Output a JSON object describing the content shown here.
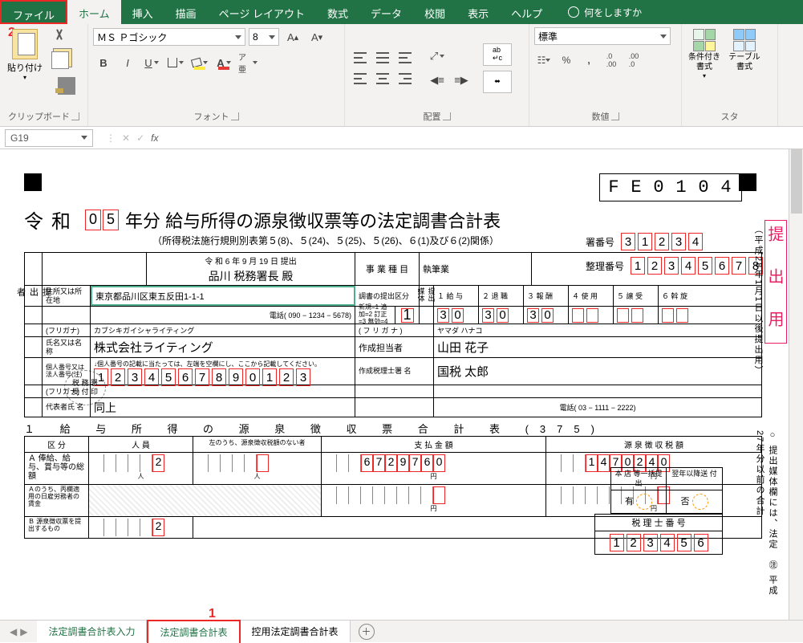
{
  "ribbon": {
    "tabs": [
      "ファイル",
      "ホーム",
      "挿入",
      "描画",
      "ページ レイアウト",
      "数式",
      "データ",
      "校閲",
      "表示",
      "ヘルプ"
    ],
    "tell_me": "何をしますか",
    "clipboard_label": "クリップボード",
    "paste_label": "貼り付け",
    "font_label": "フォント",
    "font_name": "ＭＳ Ｐゴシック",
    "font_size": "8",
    "alignment_label": "配置",
    "number_label": "数値",
    "number_format": "標準",
    "styles_label": "スタ",
    "cond_format": "条件付き書式",
    "table_format": "テーブル書式"
  },
  "fx": {
    "name_box": "G19"
  },
  "doc": {
    "code": [
      "F",
      "E",
      "0",
      "1",
      "0",
      "4"
    ],
    "era": "令和",
    "year": [
      "0",
      "5"
    ],
    "title_suffix": "年分 給与所得の源泉徴収票等の法定調書合計表",
    "subtitle": "（所得税法施行規則別表第５(8)、５(24)、５(25)、５(26)、６(1)及び６(2)関係）",
    "office_no_lbl": "署番号",
    "office_no": [
      "3",
      "1",
      "2",
      "3",
      "4"
    ],
    "seiri_lbl": "整理番号",
    "seiri": [
      "1",
      "2",
      "3",
      "4",
      "5",
      "6",
      "7",
      "8"
    ],
    "submit_date": "令 和 6 年 9 月 19 日 提出",
    "tax_office": "品川 税務署長 殿",
    "stamp_lbl1": "税 務 署",
    "stamp_lbl2": "受 付 印",
    "vert_pink": "提 出 用",
    "vert_side": "（平成28年1月1日以後提出用）",
    "vert_side2": "○ 提出媒体欄には、法定",
    "vert_side3": "㊟ 平成27年分以前の合計",
    "f": {
      "teishutsu": "提出者",
      "addr_lbl": "住所又は所在地",
      "addr": "東京都品川区東五反田1-1-1",
      "tel_lbl": "電話(",
      "tel": "090  −  1234  −  5678",
      "furi1_lbl": "(フリガナ)",
      "furi1": "カブシキガイシャライティング",
      "name_lbl": "氏名又は名  称",
      "name": "株式会社ライティング",
      "kojin_lbl": "個人番号又は法人番号(注)",
      "kojin_note": "↓個人番号の記載に当たっては、左端を空欄にし、ここから記載してください。",
      "kojin": [
        "1",
        "2",
        "3",
        "4",
        "5",
        "6",
        "7",
        "8",
        "9",
        "0",
        "1",
        "2",
        "3"
      ],
      "furi2_lbl": "(フリガナ)",
      "daihyo_lbl": "代表者氏  名",
      "daihyo": "同上",
      "gyoshu_lbl": "事 業 種 目",
      "gyoshu": "執筆業",
      "chosho_lbl": "調書の提出区分",
      "chosho_note": "新規=1 追加=2 訂正=3 無効=4",
      "chosho_val": "1",
      "media_lbl": "提出媒体",
      "media_cols": [
        "１ 給 与",
        "２ 退 職",
        "３ 報 酬",
        "４ 使 用",
        "５ 譲 受",
        "６ 斡 旋"
      ],
      "media_vals": [
        [
          "3",
          "0"
        ],
        [
          "3",
          "0"
        ],
        [
          "3",
          "0"
        ],
        [
          "",
          ""
        ],
        [
          "",
          ""
        ],
        [
          "",
          ""
        ]
      ],
      "sakusei_furi_lbl": "( フ リ ガ ナ )",
      "sakusei_furi": "ヤマダ ハナコ",
      "sakusei_lbl": "作成担当者",
      "sakusei": "山田 花子",
      "zeirishi_lbl": "作成税理士署  名",
      "zeirishi": "国税 太郎",
      "zeirishi_tel_lbl": "電話(",
      "zeirishi_tel": "03  −  1111  −  2222",
      "honten1": "本 店 等一括提出",
      "honten2": "翌年以降送  付",
      "honten_a": "有",
      "honten_b": "否",
      "zeirishi_no_lbl": "税 理 士 番 号",
      "zeirishi_no": [
        "1",
        "2",
        "3",
        "4",
        "5",
        "6"
      ]
    },
    "sec1": {
      "title": "１  給 与 所 得 の 源 泉 徴 収 票 合 計 表 (375)",
      "cols": [
        "区  分",
        "人  員",
        "",
        "支  払  金  額",
        "源 泉 徴 収 税 額"
      ],
      "note": "左のうち、源泉徴収税額のない者",
      "row1_lbl": "Ａ 俸給、給与、賞与等の総額",
      "row2_lbl": "Ａのうち、丙欄適用の日雇労務者の賃金",
      "row3_lbl": "Ｂ 源泉徴収票を提出するもの",
      "jinnin": "2",
      "pay": [
        "",
        "",
        "6",
        "7",
        "2",
        "9",
        "7",
        "6",
        "0"
      ],
      "tax": [
        "",
        "",
        "1",
        "4",
        "7",
        "0",
        "2",
        "4",
        "0"
      ],
      "yen": "円",
      "man": "人"
    }
  },
  "sheets": {
    "tabs": [
      "法定調書合計表入力",
      "法定調書合計表",
      "控用法定調書合計表"
    ],
    "active": 1
  },
  "badges": {
    "b1": "1",
    "b2": "2"
  }
}
